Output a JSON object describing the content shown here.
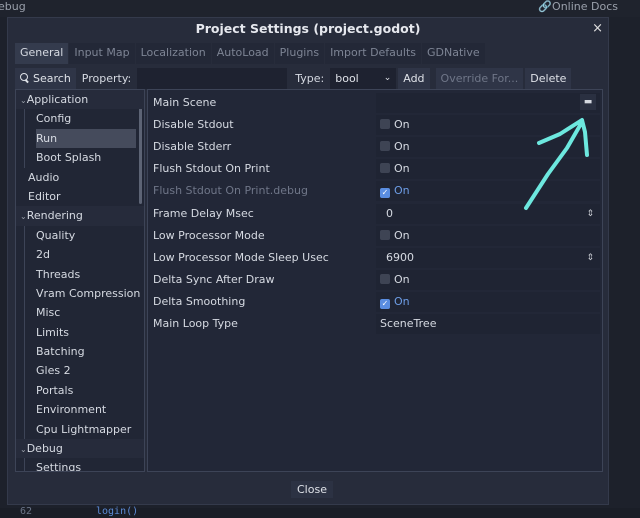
{
  "background": {
    "menu_left": "ebug",
    "online_docs": "Online Docs",
    "code_line_no": "62",
    "code_text": "login()"
  },
  "dialog": {
    "title": "Project Settings (project.godot)",
    "close_x": "×",
    "close_button": "Close"
  },
  "tabs": [
    "General",
    "Input Map",
    "Localization",
    "AutoLoad",
    "Plugins",
    "Import Defaults",
    "GDNative"
  ],
  "toolbar": {
    "search": "Search",
    "property_label": "Property:",
    "property_value": "",
    "type_label": "Type:",
    "type_value": "bool",
    "add": "Add",
    "override": "Override For...",
    "delete": "Delete"
  },
  "sidebar": [
    {
      "label": "Application",
      "kind": "section"
    },
    {
      "label": "Config",
      "kind": "sub"
    },
    {
      "label": "Run",
      "kind": "sub",
      "selected": true
    },
    {
      "label": "Boot Splash",
      "kind": "sub"
    },
    {
      "label": "Audio",
      "kind": "top"
    },
    {
      "label": "Editor",
      "kind": "top"
    },
    {
      "label": "Rendering",
      "kind": "section"
    },
    {
      "label": "Quality",
      "kind": "sub"
    },
    {
      "label": "2d",
      "kind": "sub"
    },
    {
      "label": "Threads",
      "kind": "sub"
    },
    {
      "label": "Vram Compression",
      "kind": "sub"
    },
    {
      "label": "Misc",
      "kind": "sub"
    },
    {
      "label": "Limits",
      "kind": "sub"
    },
    {
      "label": "Batching",
      "kind": "sub"
    },
    {
      "label": "Gles 2",
      "kind": "sub"
    },
    {
      "label": "Portals",
      "kind": "sub"
    },
    {
      "label": "Environment",
      "kind": "sub"
    },
    {
      "label": "Cpu Lightmapper",
      "kind": "sub"
    },
    {
      "label": "Debug",
      "kind": "section"
    },
    {
      "label": "Settings",
      "kind": "sub"
    }
  ],
  "properties": [
    {
      "name": "Main Scene",
      "type": "file",
      "value": ""
    },
    {
      "name": "Disable Stdout",
      "type": "bool",
      "checked": false,
      "value": "On"
    },
    {
      "name": "Disable Stderr",
      "type": "bool",
      "checked": false,
      "value": "On"
    },
    {
      "name": "Flush Stdout On Print",
      "type": "bool",
      "checked": false,
      "value": "On"
    },
    {
      "name": "Flush Stdout On Print.debug",
      "type": "bool",
      "checked": true,
      "value": "On",
      "dim": true
    },
    {
      "name": "Frame Delay Msec",
      "type": "int",
      "value": "0"
    },
    {
      "name": "Low Processor Mode",
      "type": "bool",
      "checked": false,
      "value": "On"
    },
    {
      "name": "Low Processor Mode Sleep Usec",
      "type": "int",
      "value": "6900"
    },
    {
      "name": "Delta Sync After Draw",
      "type": "bool",
      "checked": false,
      "value": "On"
    },
    {
      "name": "Delta Smoothing",
      "type": "bool",
      "checked": true,
      "value": "On"
    },
    {
      "name": "Main Loop Type",
      "type": "string",
      "value": "SceneTree"
    }
  ],
  "annotation": {
    "color": "#6de8df",
    "icon": "hand-drawn-arrow"
  }
}
